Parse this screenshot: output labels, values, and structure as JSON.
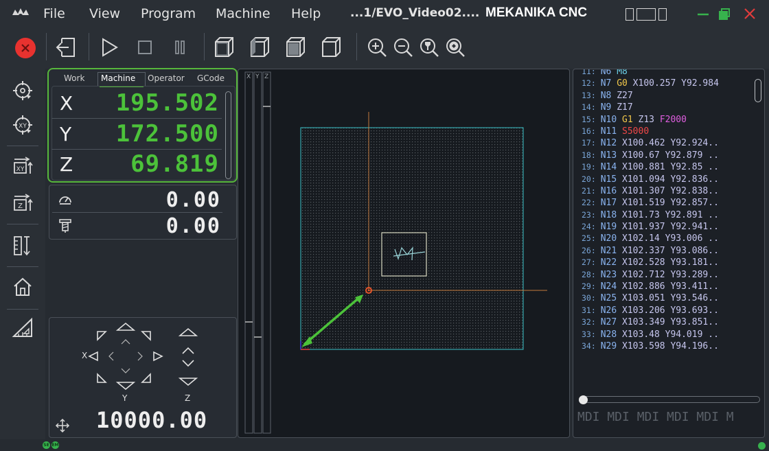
{
  "menubar": {
    "items": [
      "File",
      "View",
      "Program",
      "Machine",
      "Help"
    ],
    "file_title": "...1/EVO_Video02....",
    "app_title": "MEKANIKA CNC"
  },
  "dro": {
    "tabs": [
      "Work",
      "Machine",
      "Operator",
      "GCode"
    ],
    "active_tab": "Machine",
    "axes": [
      {
        "label": "X",
        "value": "195.502"
      },
      {
        "label": "Y",
        "value": "172.500"
      },
      {
        "label": "Z",
        "value": "69.819"
      }
    ],
    "accent_color": "#57b73c"
  },
  "speed": {
    "feed_value": "0.00",
    "spindle_value": "0.00"
  },
  "jog": {
    "x_label": "X",
    "y_label": "Y",
    "z_label": "Z",
    "step_value": "10000.00"
  },
  "axis_bars": {
    "labels": [
      "X",
      "Y",
      "Z"
    ]
  },
  "gcode": {
    "lines": [
      {
        "n": "11:",
        "parts": [
          [
            "nw",
            "N6 "
          ],
          [
            "m",
            "M8"
          ]
        ]
      },
      {
        "n": "12:",
        "parts": [
          [
            "nw",
            "N7 "
          ],
          [
            "g",
            "G0 "
          ],
          [
            "coord",
            "X100.257 Y92.984"
          ]
        ]
      },
      {
        "n": "13:",
        "parts": [
          [
            "nw",
            "N8 "
          ],
          [
            "coord",
            "Z27"
          ]
        ]
      },
      {
        "n": "14:",
        "parts": [
          [
            "nw",
            "N9 "
          ],
          [
            "coord",
            "Z17"
          ]
        ]
      },
      {
        "n": "15:",
        "parts": [
          [
            "nw",
            "N10 "
          ],
          [
            "g",
            "G1 "
          ],
          [
            "coord",
            "Z13 "
          ],
          [
            "f",
            "F2000"
          ]
        ]
      },
      {
        "n": "16:",
        "parts": [
          [
            "nw",
            "N11 "
          ],
          [
            "s",
            "S5000"
          ]
        ]
      },
      {
        "n": "17:",
        "parts": [
          [
            "nw",
            "N12 "
          ],
          [
            "coord",
            "X100.462 Y92.924.."
          ]
        ]
      },
      {
        "n": "18:",
        "parts": [
          [
            "nw",
            "N13 "
          ],
          [
            "coord",
            "X100.67 Y92.879 .."
          ]
        ]
      },
      {
        "n": "19:",
        "parts": [
          [
            "nw",
            "N14 "
          ],
          [
            "coord",
            "X100.881 Y92.85 .."
          ]
        ]
      },
      {
        "n": "20:",
        "parts": [
          [
            "nw",
            "N15 "
          ],
          [
            "coord",
            "X101.094 Y92.836.."
          ]
        ]
      },
      {
        "n": "21:",
        "parts": [
          [
            "nw",
            "N16 "
          ],
          [
            "coord",
            "X101.307 Y92.838.."
          ]
        ]
      },
      {
        "n": "22:",
        "parts": [
          [
            "nw",
            "N17 "
          ],
          [
            "coord",
            "X101.519 Y92.857.."
          ]
        ]
      },
      {
        "n": "23:",
        "parts": [
          [
            "nw",
            "N18 "
          ],
          [
            "coord",
            "X101.73 Y92.891 .."
          ]
        ]
      },
      {
        "n": "24:",
        "parts": [
          [
            "nw",
            "N19 "
          ],
          [
            "coord",
            "X101.937 Y92.941.."
          ]
        ]
      },
      {
        "n": "25:",
        "parts": [
          [
            "nw",
            "N20 "
          ],
          [
            "coord",
            "X102.14 Y93.006 .."
          ]
        ]
      },
      {
        "n": "26:",
        "parts": [
          [
            "nw",
            "N21 "
          ],
          [
            "coord",
            "X102.337 Y93.086.."
          ]
        ]
      },
      {
        "n": "27:",
        "parts": [
          [
            "nw",
            "N22 "
          ],
          [
            "coord",
            "X102.528 Y93.181.."
          ]
        ]
      },
      {
        "n": "28:",
        "parts": [
          [
            "nw",
            "N23 "
          ],
          [
            "coord",
            "X102.712 Y93.289.."
          ]
        ]
      },
      {
        "n": "29:",
        "parts": [
          [
            "nw",
            "N24 "
          ],
          [
            "coord",
            "X102.886 Y93.411.."
          ]
        ]
      },
      {
        "n": "30:",
        "parts": [
          [
            "nw",
            "N25 "
          ],
          [
            "coord",
            "X103.051 Y93.546.."
          ]
        ]
      },
      {
        "n": "31:",
        "parts": [
          [
            "nw",
            "N26 "
          ],
          [
            "coord",
            "X103.206 Y93.693.."
          ]
        ]
      },
      {
        "n": "32:",
        "parts": [
          [
            "nw",
            "N27 "
          ],
          [
            "coord",
            "X103.349 Y93.851.."
          ]
        ]
      },
      {
        "n": "33:",
        "parts": [
          [
            "nw",
            "N28 "
          ],
          [
            "coord",
            "X103.48 Y94.019 .."
          ]
        ]
      },
      {
        "n": "34:",
        "parts": [
          [
            "nw",
            "N29 "
          ],
          [
            "coord",
            "X103.598 Y94.196.."
          ]
        ]
      }
    ],
    "mdi_placeholder": "MDI MDI MDI MDI MDI M"
  },
  "status": {
    "led1": "SE",
    "led2": "EM"
  }
}
